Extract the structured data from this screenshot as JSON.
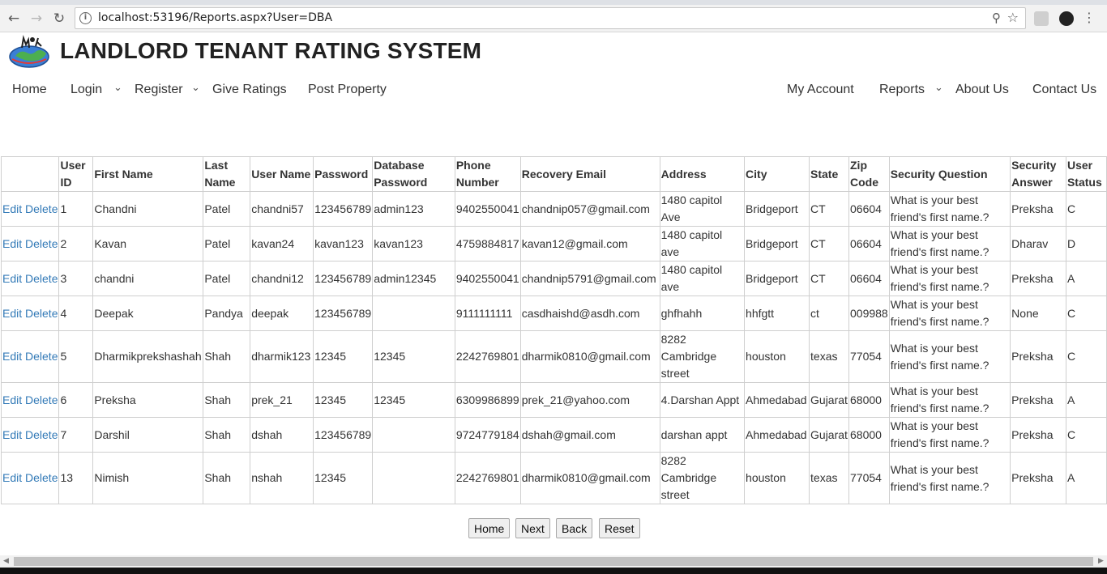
{
  "browser": {
    "url": "localhost:53196/Reports.aspx?User=DBA",
    "back_glyph": "←",
    "forward_glyph": "→",
    "reload_glyph": "↻",
    "info_glyph": "i",
    "zoom_glyph": "⚲",
    "star_glyph": "☆",
    "menu_glyph": "⋮"
  },
  "site": {
    "title": "LANDLORD TENANT RATING SYSTEM"
  },
  "nav": {
    "left": [
      "Home",
      "Login",
      "Register",
      "Give Ratings",
      "Post Property"
    ],
    "right": [
      "My Account",
      "Reports",
      "About Us",
      "Contact Us"
    ],
    "caret": "⌄"
  },
  "table": {
    "headers": [
      "",
      "User ID",
      "First Name",
      "Last Name",
      "User Name",
      "Password",
      "Database Password",
      "Phone Number",
      "Recovery Email",
      "Address",
      "City",
      "State",
      "Zip Code",
      "Security Question",
      "Security Answer",
      "User Status"
    ],
    "edit_label": "Edit",
    "delete_label": "Delete",
    "rows": [
      [
        "1",
        "Chandni",
        "Patel",
        "chandni57",
        "123456789",
        "admin123",
        "9402550041",
        "chandnip057@gmail.com",
        "1480 capitol Ave",
        "Bridgeport",
        "CT",
        "06604",
        "What is your best friend's first name.?",
        "Preksha",
        "C"
      ],
      [
        "2",
        "Kavan",
        "Patel",
        "kavan24",
        "kavan123",
        "kavan123",
        "4759884817",
        "kavan12@gmail.com",
        "1480 capitol ave",
        "Bridgeport",
        "CT",
        "06604",
        "What is your best friend's first name.?",
        "Dharav",
        "D"
      ],
      [
        "3",
        "chandni",
        "Patel",
        "chandni12",
        "123456789",
        "admin12345",
        "9402550041",
        "chandnip5791@gmail.com",
        "1480 capitol ave",
        "Bridgeport",
        "CT",
        "06604",
        "What is your best friend's first name.?",
        "Preksha",
        "A"
      ],
      [
        "4",
        "Deepak",
        "Pandya",
        "deepak",
        "123456789",
        "",
        "9111111111",
        "casdhaishd@asdh.com",
        "ghfhahh",
        "hhfgtt",
        "ct",
        "009988",
        "What is your best friend's first name.?",
        "None",
        "C"
      ],
      [
        "5",
        "Dharmikprekshashah",
        "Shah",
        "dharmik123",
        "12345",
        "12345",
        "2242769801",
        "dharmik0810@gmail.com",
        "8282 Cambridge street",
        "houston",
        "texas",
        "77054",
        "What is your best friend's first name.?",
        "Preksha",
        "C"
      ],
      [
        "6",
        "Preksha",
        "Shah",
        "prek_21",
        "12345",
        "12345",
        "6309986899",
        "prek_21@yahoo.com",
        "4.Darshan Appt",
        "Ahmedabad",
        "Gujarat",
        "68000",
        "What is your best friend's first name.?",
        "Preksha",
        "A"
      ],
      [
        "7",
        "Darshil",
        "Shah",
        "dshah",
        "123456789",
        "",
        "9724779184",
        "dshah@gmail.com",
        "darshan appt",
        "Ahmedabad",
        "Gujarat",
        "68000",
        "What is your best friend's first name.?",
        "Preksha",
        "C"
      ],
      [
        "13",
        "Nimish",
        "Shah",
        "nshah",
        "12345",
        "",
        "2242769801",
        "dharmik0810@gmail.com",
        "8282 Cambridge street",
        "houston",
        "texas",
        "77054",
        "What is your best friend's first name.?",
        "Preksha",
        "A"
      ]
    ]
  },
  "buttons": {
    "home": "Home",
    "next": "Next",
    "back": "Back",
    "reset": "Reset"
  },
  "scrollbar": {
    "left_arrow": "◀",
    "right_arrow": "▶"
  }
}
